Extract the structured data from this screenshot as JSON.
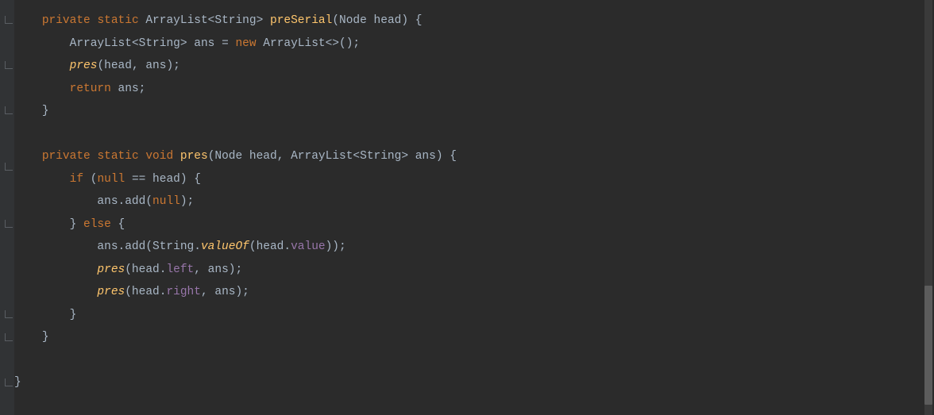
{
  "code": {
    "line1": {
      "kw1": "private",
      "kw2": "static",
      "type": "ArrayList<String>",
      "method": "preSerial",
      "params": "(Node head) {"
    },
    "line2": {
      "type": "ArrayList<String>",
      "var": "ans",
      "eq": " = ",
      "kw": "new",
      "ctor": " ArrayList<>();"
    },
    "line3": {
      "call": "pres",
      "args": "(head, ans);"
    },
    "line4": {
      "kw": "return",
      "rest": " ans;"
    },
    "line5": {
      "brace": "}"
    },
    "line6": {
      "blank": ""
    },
    "line7": {
      "kw1": "private",
      "kw2": "static",
      "kw3": "void",
      "method": "pres",
      "params": "(Node head, ArrayList<String> ans) {"
    },
    "line8": {
      "kw": "if",
      "cond": " (",
      "kw2": "null",
      "op": " == head) {"
    },
    "line9": {
      "obj": "ans.add(",
      "kw": "null",
      "close": ");"
    },
    "line10": {
      "brace": "} ",
      "kw": "else",
      "open": " {"
    },
    "line11": {
      "call": "ans.add(String.",
      "method": "valueOf",
      "mid": "(head.",
      "fld": "value",
      "close": "));"
    },
    "line12": {
      "call": "pres",
      "open": "(head.",
      "fld": "left",
      "close": ", ans);"
    },
    "line13": {
      "call": "pres",
      "open": "(head.",
      "fld": "right",
      "close": ", ans);"
    },
    "line14": {
      "brace": "}"
    },
    "line15": {
      "brace": "}"
    },
    "line16": {
      "blank": ""
    },
    "line17": {
      "brace": "}"
    }
  },
  "indent": {
    "i1": "    ",
    "i2": "        ",
    "i3": "            "
  }
}
